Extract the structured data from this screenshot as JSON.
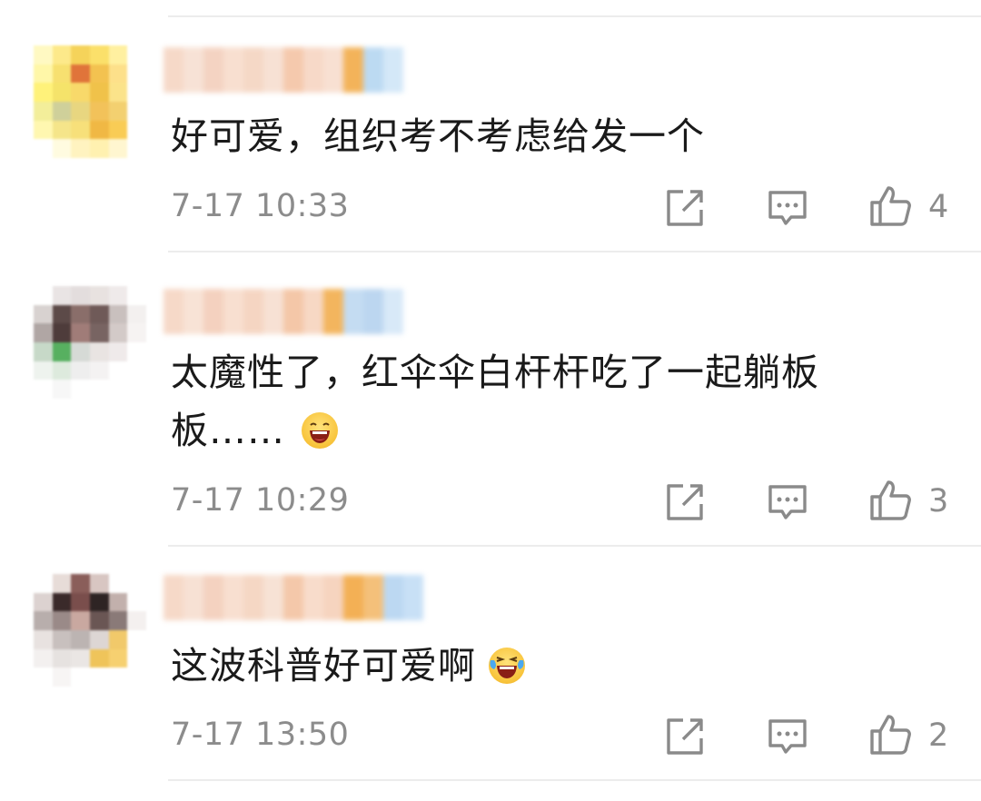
{
  "comments": [
    {
      "text": "好可爱，组织考不考虑给发一个",
      "time": "7-17 10:33",
      "likes": "4",
      "avatar_colors": [
        "#fff9c2",
        "#fde98a",
        "#f5d35a",
        "#fbe06a",
        "#fff0a0",
        "#ffffff",
        "#fff7a8",
        "#f7e070",
        "#e0743a",
        "#f3c250",
        "#fde08a",
        "#ffffff",
        "#fff27a",
        "#f5e36a",
        "#f8d96a",
        "#f0c24a",
        "#fbe38a",
        "#ffffff",
        "#f3ee9a",
        "#cfd09a",
        "#e8d680",
        "#f2c25a",
        "#f3d070",
        "#ffffff",
        "#fff7b0",
        "#f5e58a",
        "#f7e07a",
        "#f0b844",
        "#f9cc55",
        "#ffffff",
        "#ffffff",
        "#fffbe0",
        "#fff3c0",
        "#fff1b0",
        "#fff6d0",
        "#ffffff"
      ],
      "name_colors": [
        "#f6d9c8",
        "#f7e2d6",
        "#f4d3c2",
        "#f8dfd0",
        "#f5d8c6",
        "#f7e1d4",
        "#f5c9ad",
        "#f7d9c8",
        "#f8e0d2",
        "#f3b35a",
        "#bcdaf2",
        "#d4e8f8"
      ]
    },
    {
      "text": "太魔性了，红伞伞白杆杆吃了一起躺板板……",
      "time": "7-17 10:29",
      "likes": "3",
      "avatar_colors": [
        "#ffffff",
        "#e9e4e4",
        "#e3dddd",
        "#e8e2e0",
        "#efeaea",
        "#ffffff",
        "#d8d2d0",
        "#5c4a48",
        "#8a6e6a",
        "#6f5a58",
        "#c9c0be",
        "#f3f0ef",
        "#b0a6a4",
        "#4e3c3b",
        "#a07c78",
        "#786462",
        "#d3cac8",
        "#f6f3f2",
        "#c7d9c8",
        "#57b060",
        "#d6dad6",
        "#e9e4e2",
        "#efeaea",
        "#ffffff",
        "#eef3ee",
        "#ddeadd",
        "#eeeeee",
        "#f4f2f2",
        "#ffffff",
        "#ffffff",
        "#ffffff",
        "#f7f7f7",
        "#ffffff",
        "#ffffff",
        "#ffffff",
        "#ffffff"
      ],
      "name_colors": [
        "#f6d9c8",
        "#f8e3d6",
        "#f4d1bf",
        "#f8dfd0",
        "#f5d5c2",
        "#f7e1d4",
        "#f4c7a8",
        "#f7d8c4",
        "#f3b55e",
        "#c4dcf2",
        "#bcd6f0",
        "#d8e9f8"
      ]
    },
    {
      "text": "这波科普好可爱啊",
      "time": "7-17 13:50",
      "likes": "2",
      "avatar_colors": [
        "#ffffff",
        "#e7dcd8",
        "#8a5e5a",
        "#d8c6c2",
        "#ffffff",
        "#ffffff",
        "#dcd2d0",
        "#3a2a2a",
        "#7a4e4c",
        "#2e2424",
        "#c2b0ac",
        "#ffffff",
        "#b8aeac",
        "#9a8a88",
        "#c9a8a0",
        "#6a5654",
        "#8a7a78",
        "#f4f0ef",
        "#e8e2e0",
        "#c8c0be",
        "#bcb4b2",
        "#ddd6d4",
        "#f1c96a",
        "#ffffff",
        "#f3f0ef",
        "#e6e2e0",
        "#eae6e4",
        "#efc45a",
        "#f6d070",
        "#ffffff",
        "#ffffff",
        "#f7f5f4",
        "#ffffff",
        "#ffffff",
        "#ffffff",
        "#ffffff"
      ],
      "name_colors": [
        "#f6d9c8",
        "#f7e1d4",
        "#f4d2c0",
        "#f8dfd0",
        "#f5d7c4",
        "#f7e2d5",
        "#f4c8aa",
        "#f8dccb",
        "#f6d4bf",
        "#f3b055",
        "#f4c07a",
        "#bcd8f2",
        "#c8e0f6"
      ]
    }
  ],
  "icons": {
    "forward": "share-square-icon",
    "reply": "comment-bubble-icon",
    "like": "thumbs-up-icon"
  },
  "colors": {
    "text": "#1a1a1a",
    "meta": "#8c8c8c",
    "divider": "#ececec"
  }
}
